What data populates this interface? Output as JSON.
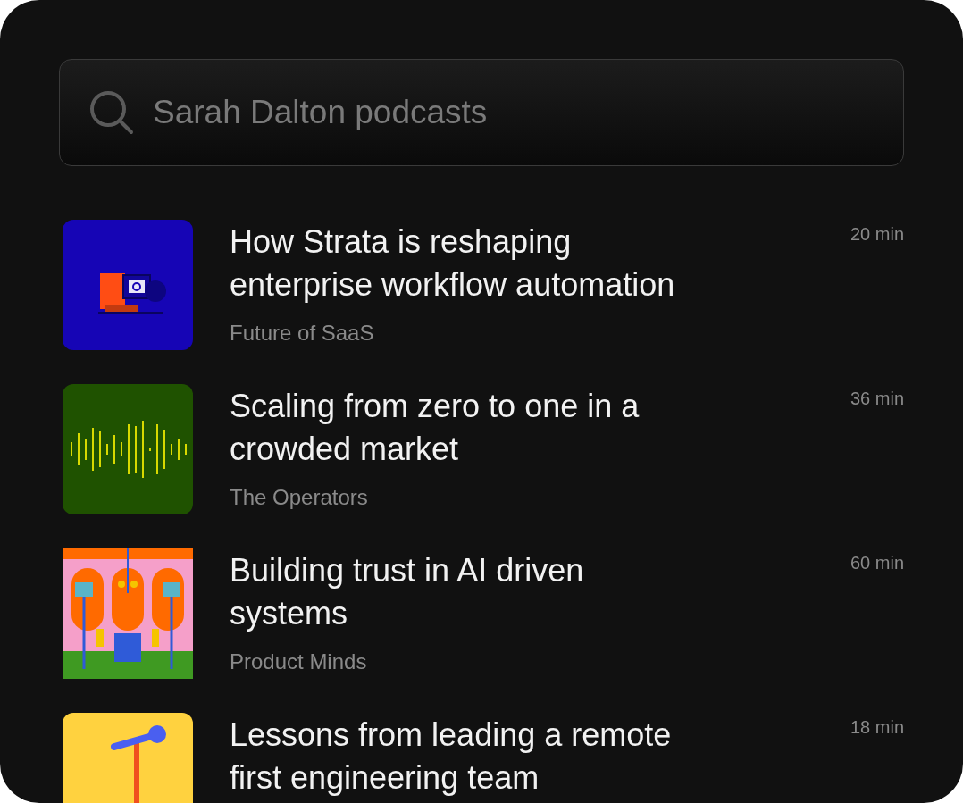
{
  "search": {
    "value": "Sarah Dalton podcasts"
  },
  "episodes": [
    {
      "title": "How Strata is reshaping enterprise workflow automation",
      "show": "Future of SaaS",
      "duration": "20 min",
      "kind": "robot"
    },
    {
      "title": "Scaling from zero to one in a crowded market",
      "show": "The Operators",
      "duration": "36 min",
      "kind": "waveform"
    },
    {
      "title": "Building trust in AI driven systems",
      "show": "Product Minds",
      "duration": "60 min",
      "kind": "studio"
    },
    {
      "title": "Lessons from leading a remote first engineering team",
      "duration": "18 min",
      "kind": "microphone"
    }
  ]
}
